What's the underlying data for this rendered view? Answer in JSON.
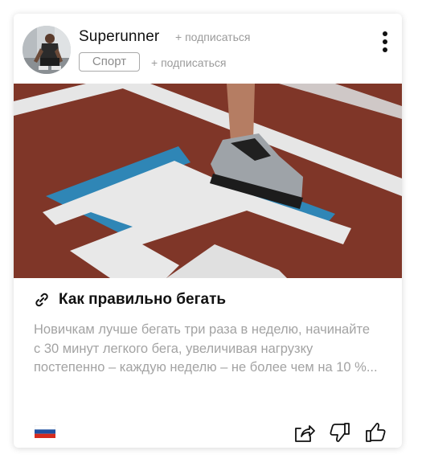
{
  "post": {
    "author": "Superunner",
    "subscribe_author": "+ подписаться",
    "category": "Спорт",
    "subscribe_category": "+ подписаться",
    "title": "Как правильно бегать",
    "excerpt": "Новичкам лучше бегать три раза в неделю, начинайте с 30 минут легкого бега, увеличивая нагрузку постепенно – каждую неделю – не более чем на 10 %..."
  },
  "icons": {
    "menu": "more-vertical-icon",
    "link": "link-icon",
    "flag": "russia-flag-icon",
    "share": "share-icon",
    "dislike": "thumbs-down-icon",
    "like": "thumbs-up-icon"
  },
  "colors": {
    "track": "#7a3326",
    "lane_lines": "#e8e8e8",
    "accent_blue": "#2e86b8",
    "muted_text": "#a3a3a3"
  }
}
